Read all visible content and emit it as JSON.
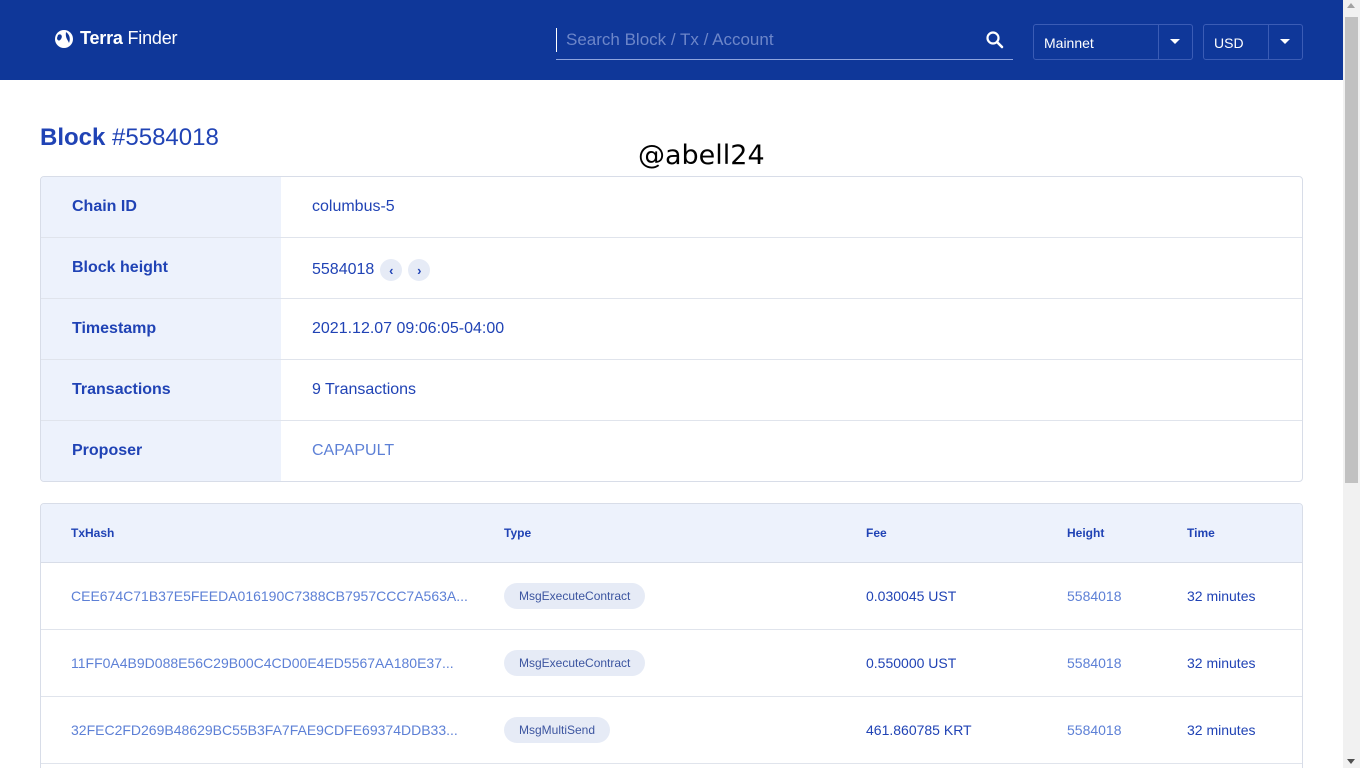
{
  "header": {
    "brand_bold": "Terra",
    "brand_light": " Finder",
    "search_placeholder": "Search Block / Tx / Account",
    "network": "Mainnet",
    "currency": "USD"
  },
  "page": {
    "title_label": "Block",
    "title_value": "#5584018",
    "watermark": "@abell24"
  },
  "block_info": [
    {
      "label": "Chain ID",
      "value": "columbus-5"
    },
    {
      "label": "Block height",
      "value": "5584018"
    },
    {
      "label": "Timestamp",
      "value": "2021.12.07 09:06:05-04:00"
    },
    {
      "label": "Transactions",
      "value": "9 Transactions"
    },
    {
      "label": "Proposer",
      "value": "CAPAPULT"
    }
  ],
  "tx_table": {
    "columns": [
      "TxHash",
      "Type",
      "Fee",
      "Height",
      "Time"
    ],
    "rows": [
      {
        "hash": "CEE674C71B37E5FEEDA016190C7388CB7957CCC7A563A...",
        "type": "MsgExecuteContract",
        "fee": "0.030045 UST",
        "height": "5584018",
        "time": "32 minutes"
      },
      {
        "hash": "11FF0A4B9D088E56C29B00C4CD00E4ED5567AA180E37...",
        "type": "MsgExecuteContract",
        "fee": "0.550000 UST",
        "height": "5584018",
        "time": "32 minutes"
      },
      {
        "hash": "32FEC2FD269B48629BC55B3FA7FAE9CDFE69374DDB33...",
        "type": "MsgMultiSend",
        "fee": "461.860785 KRT",
        "height": "5584018",
        "time": "32 minutes"
      }
    ]
  },
  "colors": {
    "header_bg": "#0f3799",
    "primary_text": "#2043b5",
    "link": "#5d80d6",
    "label_bg": "#edf2fc"
  },
  "icons": [
    "terra-logo-icon",
    "search-icon",
    "chevron-down-icon",
    "chevron-left-icon",
    "chevron-right-icon"
  ]
}
